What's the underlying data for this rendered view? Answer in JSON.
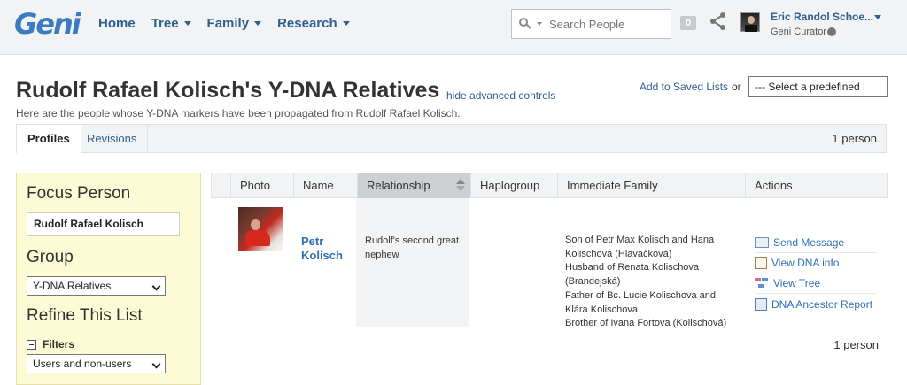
{
  "header": {
    "logo": "Geni",
    "nav": [
      {
        "label": "Home",
        "caret": false
      },
      {
        "label": "Tree",
        "caret": true
      },
      {
        "label": "Family",
        "caret": true
      },
      {
        "label": "Research",
        "caret": true
      }
    ],
    "search_placeholder": "Search People",
    "notification_count": "0",
    "user_name": "Eric Randol Schoe...",
    "user_role": "Geni Curator"
  },
  "page": {
    "title": "Rudolf Rafael Kolisch's Y-DNA Relatives",
    "advanced_link": "hide advanced controls",
    "subtitle": "Here are the people whose Y-DNA markers have been propagated from Rudolf Rafael Kolisch.",
    "saved_lists_link": "Add to Saved Lists",
    "or_text": "or",
    "predefined_select": "--- Select a predefined l"
  },
  "tabs": {
    "profiles": "Profiles",
    "revisions": "Revisions",
    "count": "1 person"
  },
  "sidebar": {
    "focus_heading": "Focus Person",
    "focus_value": "Rudolf Rafael Kolisch",
    "group_heading": "Group",
    "group_value": "Y-DNA Relatives",
    "refine_heading": "Refine This List",
    "filters_label": "Filters",
    "users_value": "Users and non-users"
  },
  "table": {
    "columns": [
      "Photo",
      "Name",
      "Relationship",
      "Haplogroup",
      "Immediate Family",
      "Actions"
    ],
    "rows": [
      {
        "name_first": "Petr",
        "name_last": "Kolisch",
        "relationship": "Rudolf's second great nephew",
        "haplogroup": "",
        "family": [
          "Son of Petr Max Kolisch and Hana Kolischova (Hlaváčková)",
          "Husband of Renata Kolischova (Brandejská)",
          "Father of Bc. Lucie Kolischova and Klára Kolischova",
          "Brother of Ivana Fortova (Kolischová)"
        ],
        "actions": [
          "Send Message",
          "View DNA info",
          "View Tree",
          "DNA Ancestor Report"
        ]
      }
    ],
    "count_bottom": "1 person"
  },
  "icons": {
    "search": "search-icon",
    "share": "share-icon",
    "globe": "globe-icon"
  },
  "colors": {
    "brand": "#3b7bc0",
    "link": "#2f5f8f",
    "sidebar_bg": "#fdfbd5"
  }
}
